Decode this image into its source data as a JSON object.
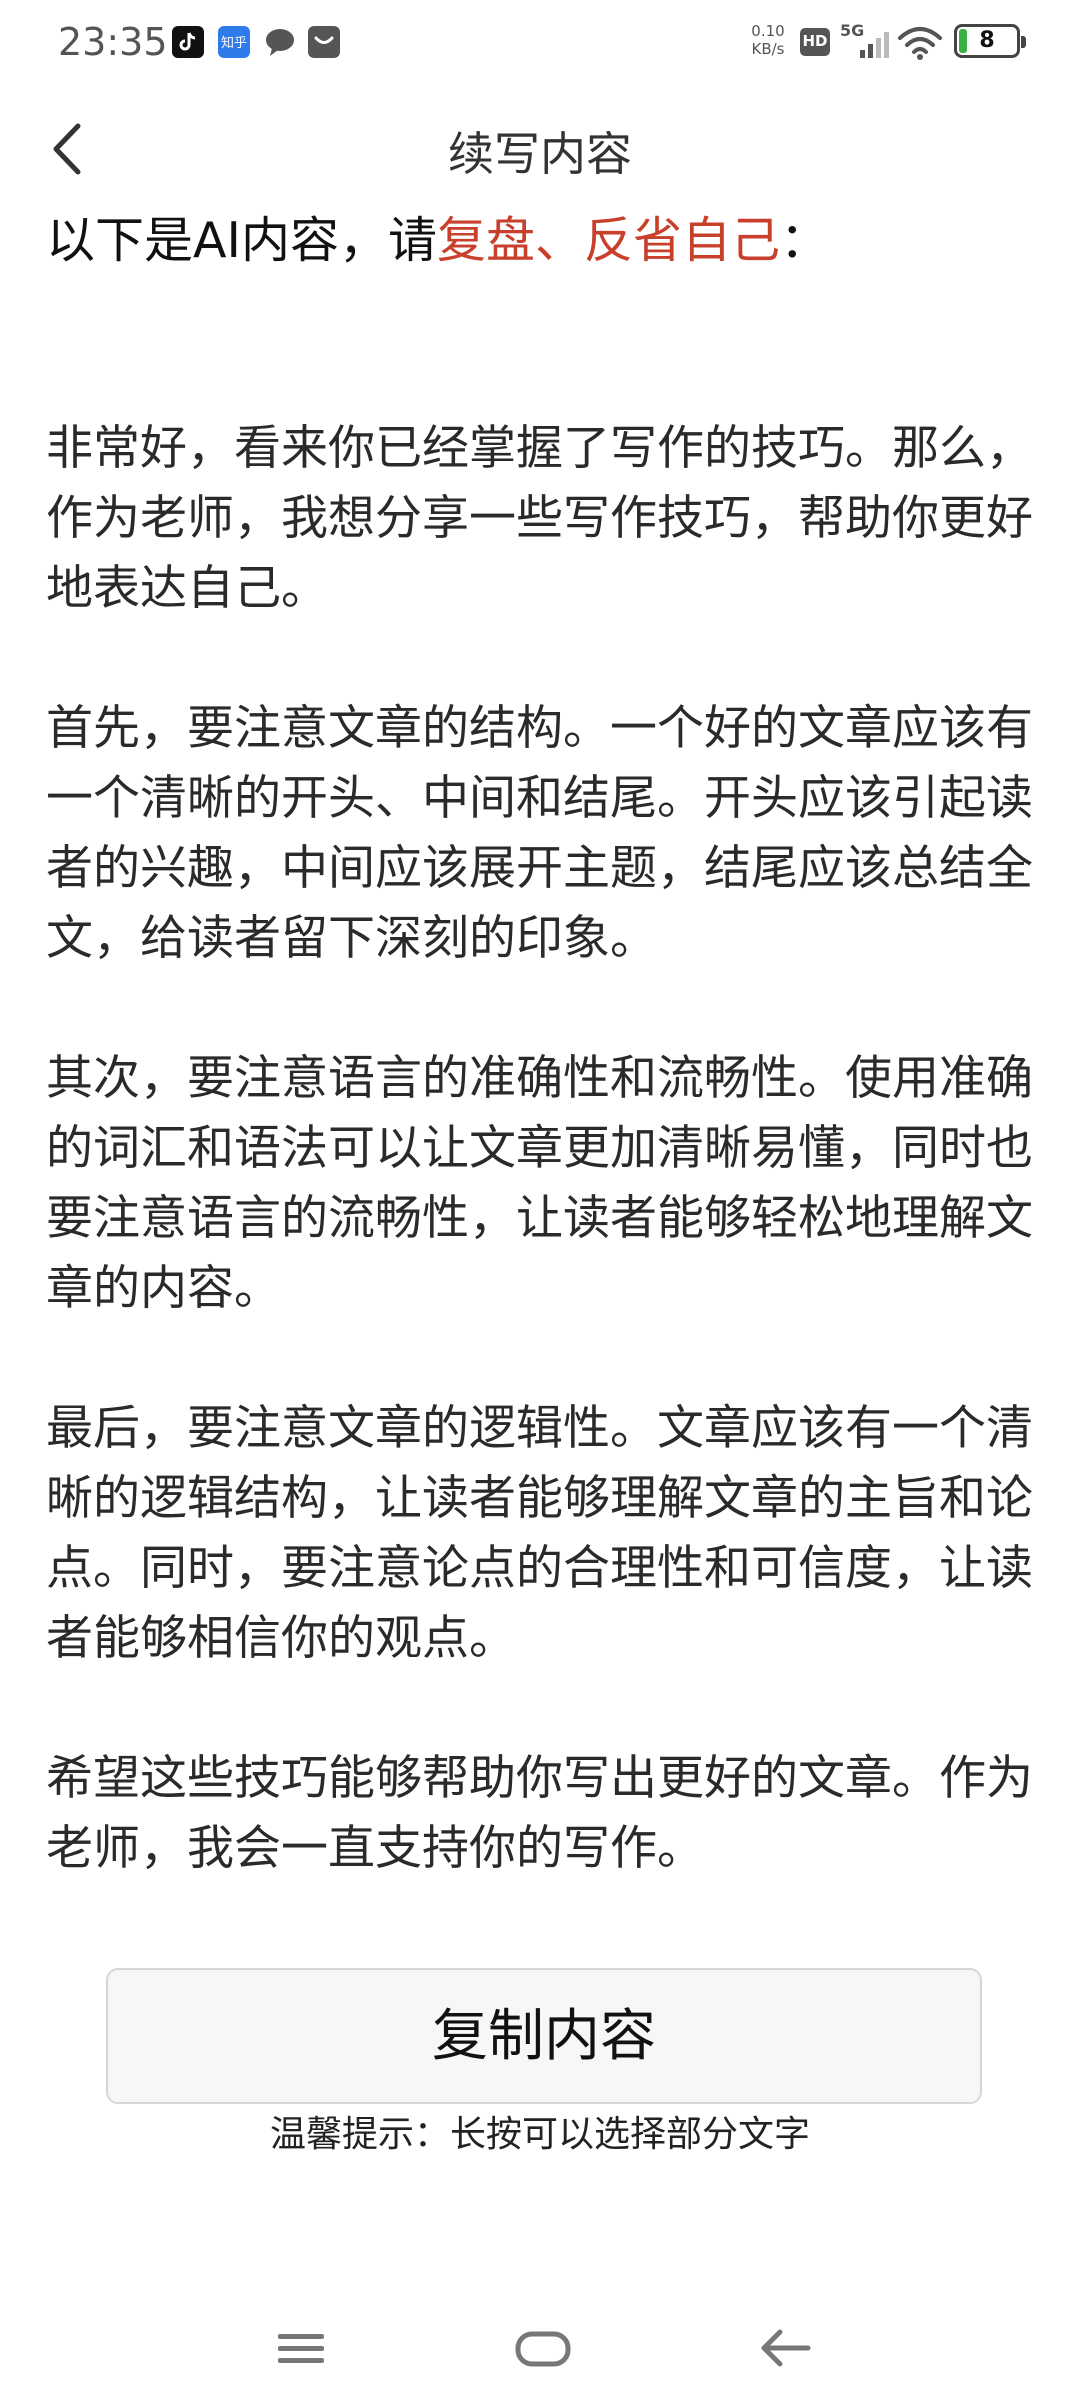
{
  "status_bar": {
    "time": "23:35",
    "notifications": [
      "tiktok-icon",
      "zhihu-icon",
      "chat-bubble-icon",
      "mail-icon"
    ],
    "zhihu_label": "知乎",
    "net_speed_value": "0.10",
    "net_speed_unit": "KB/s",
    "hd_label": "HD",
    "network_type": "5G",
    "battery_level": "8"
  },
  "header": {
    "title": "续写内容"
  },
  "intro": {
    "prefix": "以下是AI内容，请",
    "highlight": "复盘、反省自己",
    "suffix": "：",
    "highlight_color": "#c8402c"
  },
  "content": {
    "paragraphs": [
      "非常好，看来你已经掌握了写作的技巧。那么，作为老师，我想分享一些写作技巧，帮助你更好地表达自己。",
      "首先，要注意文章的结构。一个好的文章应该有一个清晰的开头、中间和结尾。开头应该引起读者的兴趣，中间应该展开主题，结尾应该总结全文，给读者留下深刻的印象。",
      "其次，要注意语言的准确性和流畅性。使用准确的词汇和语法可以让文章更加清晰易懂，同时也要注意语言的流畅性，让读者能够轻松地理解文章的内容。",
      "最后，要注意文章的逻辑性。文章应该有一个清晰的逻辑结构，让读者能够理解文章的主旨和论点。同时，要注意论点的合理性和可信度，让读者能够相信你的观点。",
      "希望这些技巧能够帮助你写出更好的文章。作为老师，我会一直支持你的写作。"
    ]
  },
  "actions": {
    "copy_label": "复制内容",
    "tip": "温馨提示：长按可以选择部分文字"
  },
  "nav_bar": {
    "icons": [
      "menu-icon",
      "home-icon",
      "back-arrow-icon"
    ]
  }
}
